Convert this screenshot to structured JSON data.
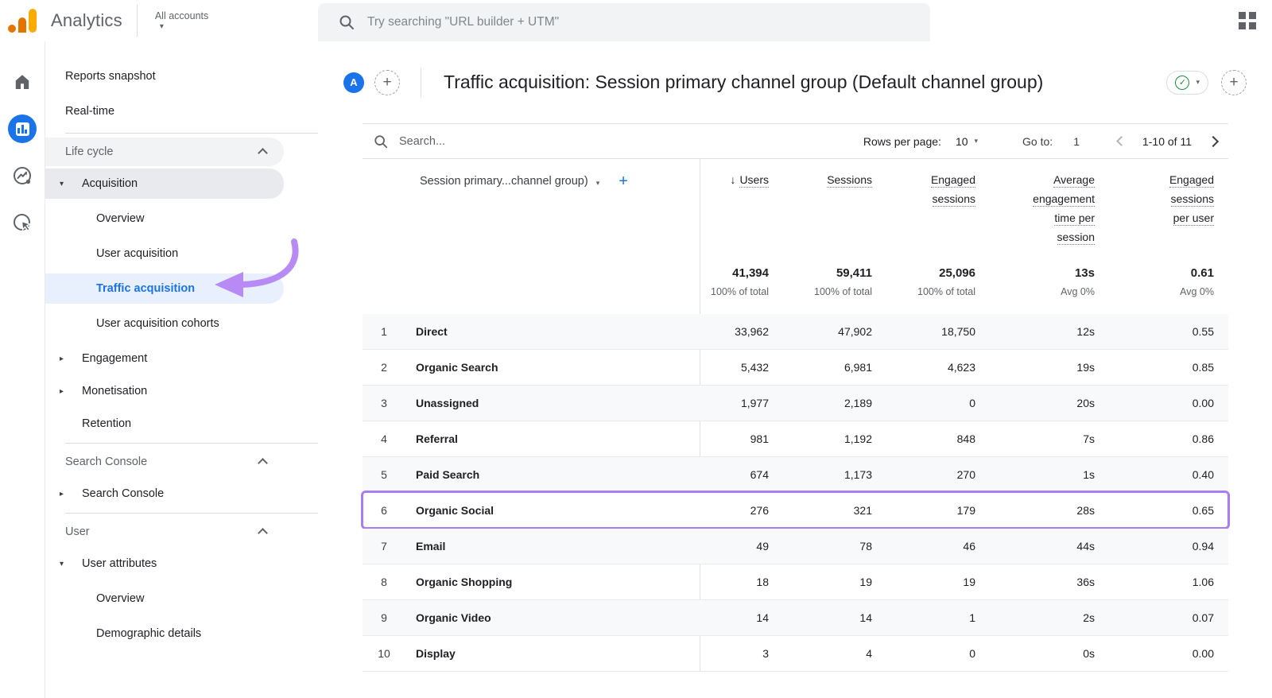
{
  "appbar": {
    "brand": "Analytics",
    "account_switcher": "All accounts",
    "search_placeholder": "Try searching \"URL builder + UTM\""
  },
  "rail": {
    "items": [
      "home",
      "reports",
      "explore",
      "advertising"
    ],
    "active": "reports"
  },
  "sidebar": {
    "top_items": [
      {
        "label": "Reports snapshot"
      },
      {
        "label": "Real-time"
      }
    ],
    "life_cycle": {
      "label": "Life cycle",
      "acquisition": {
        "label": "Acquisition",
        "children": [
          {
            "label": "Overview"
          },
          {
            "label": "User acquisition"
          },
          {
            "label": "Traffic acquisition",
            "selected": true
          },
          {
            "label": "User acquisition cohorts"
          }
        ]
      },
      "engagement_label": "Engagement",
      "monetisation_label": "Monetisation",
      "retention_label": "Retention"
    },
    "search_console": {
      "label": "Search Console",
      "item_label": "Search Console"
    },
    "user": {
      "label": "User",
      "user_attributes_label": "User attributes",
      "children": [
        {
          "label": "Overview"
        },
        {
          "label": "Demographic details"
        }
      ]
    }
  },
  "title_bar": {
    "avatar_letter": "A",
    "title": "Traffic acquisition: Session primary channel group (Default channel group)"
  },
  "table": {
    "search_placeholder": "Search...",
    "rows_per_page_label": "Rows per page:",
    "rows_per_page_value": "10",
    "goto_label": "Go to:",
    "goto_value": "1",
    "range_label": "1-10 of 11",
    "dimension_header": "Session primary...channel group)",
    "columns": [
      {
        "lines": [
          "Users"
        ],
        "sorted": "desc"
      },
      {
        "lines": [
          "Sessions"
        ]
      },
      {
        "lines": [
          "Engaged",
          "sessions"
        ]
      },
      {
        "lines": [
          "Average",
          "engagement",
          "time per",
          "session"
        ]
      },
      {
        "lines": [
          "Engaged",
          "sessions",
          "per user"
        ]
      }
    ],
    "totals": {
      "values": [
        "41,394",
        "59,411",
        "25,096",
        "13s",
        "0.61"
      ],
      "subs": [
        "100% of total",
        "100% of total",
        "100% of total",
        "Avg 0%",
        "Avg 0%"
      ]
    },
    "rows": [
      {
        "n": "1",
        "channel": "Direct",
        "values": [
          "33,962",
          "47,902",
          "18,750",
          "12s",
          "0.55"
        ]
      },
      {
        "n": "2",
        "channel": "Organic Search",
        "values": [
          "5,432",
          "6,981",
          "4,623",
          "19s",
          "0.85"
        ]
      },
      {
        "n": "3",
        "channel": "Unassigned",
        "values": [
          "1,977",
          "2,189",
          "0",
          "20s",
          "0.00"
        ]
      },
      {
        "n": "4",
        "channel": "Referral",
        "values": [
          "981",
          "1,192",
          "848",
          "7s",
          "0.86"
        ]
      },
      {
        "n": "5",
        "channel": "Paid Search",
        "values": [
          "674",
          "1,173",
          "270",
          "1s",
          "0.40"
        ]
      },
      {
        "n": "6",
        "channel": "Organic Social",
        "values": [
          "276",
          "321",
          "179",
          "28s",
          "0.65"
        ],
        "highlighted": true
      },
      {
        "n": "7",
        "channel": "Email",
        "values": [
          "49",
          "78",
          "46",
          "44s",
          "0.94"
        ]
      },
      {
        "n": "8",
        "channel": "Organic Shopping",
        "values": [
          "18",
          "19",
          "19",
          "36s",
          "1.06"
        ]
      },
      {
        "n": "9",
        "channel": "Organic Video",
        "values": [
          "14",
          "14",
          "1",
          "2s",
          "0.07"
        ]
      },
      {
        "n": "10",
        "channel": "Display",
        "values": [
          "3",
          "4",
          "0",
          "0s",
          "0.00"
        ]
      }
    ]
  },
  "icons": {
    "logo": "ga-bar-logo",
    "search": "magnifier",
    "apps": "grid-2x2",
    "status": "green-check-circle",
    "annotation": "purple-curved-arrow"
  },
  "colors": {
    "accent_blue": "#1a73e8",
    "selected_bg": "#e8f0fe",
    "highlight_purple": "#a97df1",
    "check_green": "#1e8e3e",
    "logo_yellow": "#f9ab00",
    "logo_orange": "#e37400"
  }
}
